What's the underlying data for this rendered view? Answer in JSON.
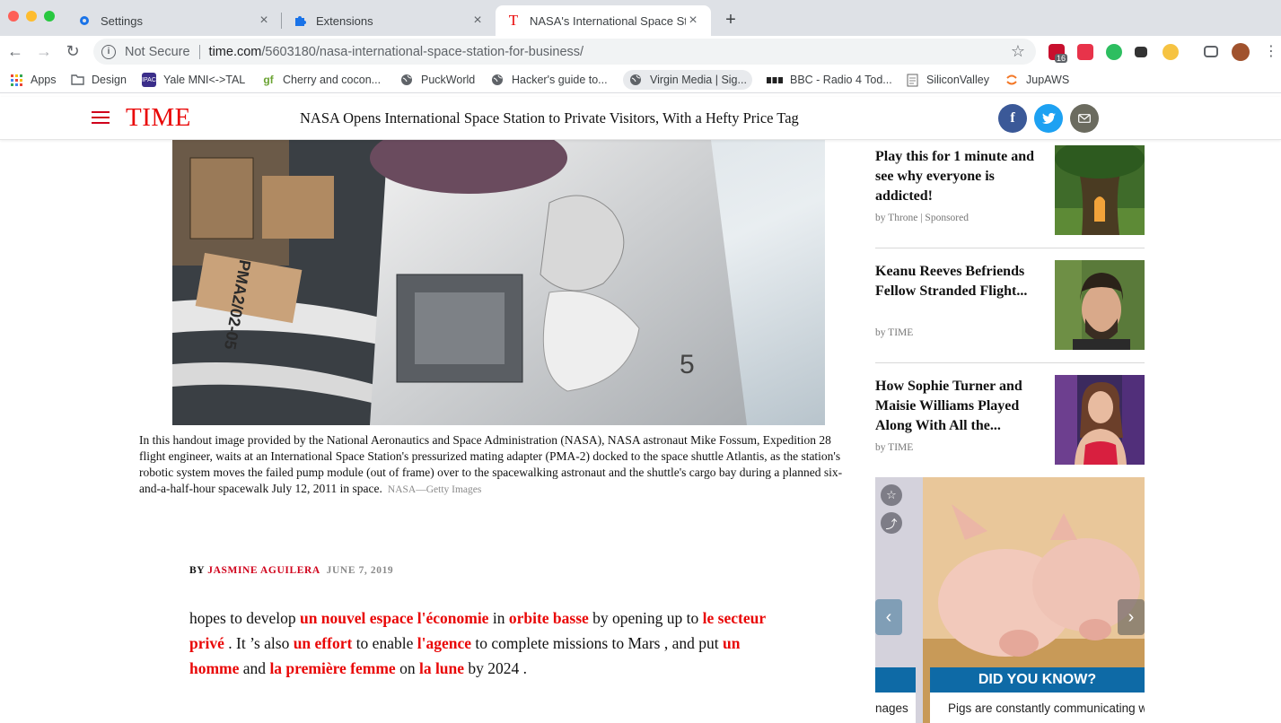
{
  "browser": {
    "tabs": [
      {
        "title": "Settings",
        "icon": "gear-icon"
      },
      {
        "title": "Extensions",
        "icon": "puzzle-icon"
      },
      {
        "title": "NASA's International Space Sta",
        "icon": "time-favicon"
      }
    ],
    "url": {
      "security_label": "Not Secure",
      "host": "time.com",
      "path": "/5603180/nasa-international-space-station-for-business/"
    },
    "extension_badge": "16",
    "bookmarks": [
      {
        "label": "Apps"
      },
      {
        "label": "Design"
      },
      {
        "label": "Yale MNI<->TAL"
      },
      {
        "label": "Cherry and cocon..."
      },
      {
        "label": "PuckWorld"
      },
      {
        "label": "Hacker's guide to..."
      },
      {
        "label": "Virgin Media | Sig..."
      },
      {
        "label": "BBC - Radio 4 Tod..."
      },
      {
        "label": "SiliconValley"
      },
      {
        "label": "JupAWS"
      }
    ]
  },
  "site": {
    "logo": "TIME",
    "headline": "NASA Opens International Space Station to Private Visitors, With a Hefty Price Tag",
    "share_email_icon": "email-icon"
  },
  "article": {
    "caption": "In this handout image provided by the National Aeronautics and Space Administration (NASA), NASA astronaut Mike Fossum, Expedition 28 flight engineer, waits at an International Space Station's pressurized mating adapter (PMA-2) docked to the space shuttle Atlantis, as the station's robotic system moves the failed pump module (out of frame) over to the spacewalking astronaut and the shuttle's cargo bay during a planned six-and-a-half-hour spacewalk July 12, 2011 in space.",
    "credit": "NASA—Getty Images",
    "hero_label": "PMA2/02-05",
    "hero_number": "5",
    "byline_prefix": "BY",
    "author": "JASMINE AGUILERA",
    "date": "JUNE 7, 2019",
    "body": [
      {
        "t": "hopes to develop ",
        "hl": false
      },
      {
        "t": "un nouvel espace l'économie",
        "hl": true
      },
      {
        "t": " in ",
        "hl": false
      },
      {
        "t": "orbite basse",
        "hl": true
      },
      {
        "t": " by opening up to ",
        "hl": false
      },
      {
        "t": "le secteur privé",
        "hl": true
      },
      {
        "t": " . It ’s also ",
        "hl": false
      },
      {
        "t": "un effort",
        "hl": true
      },
      {
        "t": " to enable ",
        "hl": false
      },
      {
        "t": "l'agence",
        "hl": true
      },
      {
        "t": " to complete missions to Mars , and put ",
        "hl": false
      },
      {
        "t": "un homme",
        "hl": true
      },
      {
        "t": " and ",
        "hl": false
      },
      {
        "t": "la première femme",
        "hl": true
      },
      {
        "t": " on ",
        "hl": false
      },
      {
        "t": "la lune",
        "hl": true
      },
      {
        "t": " by 2024 .",
        "hl": false
      }
    ]
  },
  "sidebar": {
    "cards": [
      {
        "title": "Play this for 1 minute and see why everyone is addicted!",
        "by": "by Throne | Sponsored"
      },
      {
        "title": "Keanu Reeves Befriends Fellow Stranded Flight...",
        "by": "by TIME"
      },
      {
        "title": "How Sophie Turner and Maisie Williams Played Along With All the...",
        "by": "by TIME"
      }
    ],
    "ad": {
      "heading": "DID YOU KNOW?",
      "text": "Pigs are constantly communicating w",
      "left_text": "nages"
    }
  }
}
